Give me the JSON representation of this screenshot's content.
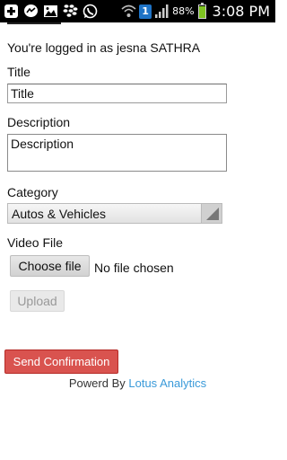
{
  "status_bar": {
    "battery_percent": "88%",
    "time": "3:08 PM",
    "notification_badge": "1",
    "icons": [
      "add-icon",
      "messenger-icon",
      "image-icon",
      "blackberry-icon",
      "whatsapp-icon",
      "wifi-icon",
      "signal-icon",
      "battery-icon"
    ]
  },
  "page": {
    "logged_in_text": "You're logged in as jesna SATHRA"
  },
  "form": {
    "title_label": "Title",
    "title_placeholder": "Title",
    "description_label": "Description",
    "description_placeholder": "Description",
    "category_label": "Category",
    "category_selected": "Autos & Vehicles",
    "video_label": "Video File",
    "choose_file_label": "Choose file",
    "no_file_text": "No file chosen",
    "upload_label": "Upload",
    "send_confirmation_label": "Send Confirmation"
  },
  "footer": {
    "prefix": "Powerd By ",
    "link": "Lotus Analytics"
  },
  "colors": {
    "accent_red": "#d9534f",
    "link_blue": "#3a9ad9",
    "badge_blue": "#1e73c6",
    "battery_green": "#7ec321"
  }
}
